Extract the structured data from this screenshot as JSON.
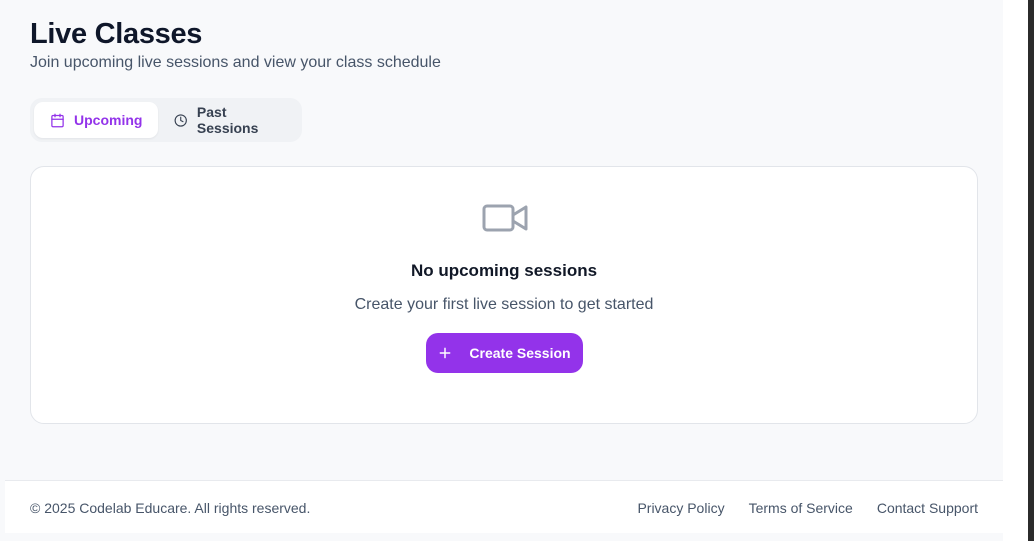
{
  "header": {
    "title": "Live Classes",
    "subtitle": "Join upcoming live sessions and view your class schedule"
  },
  "tabs": [
    {
      "label": "Upcoming",
      "icon": "calendar-icon",
      "active": true
    },
    {
      "label": "Past Sessions",
      "icon": "clock-icon",
      "active": false
    }
  ],
  "empty_state": {
    "icon": "video-camera-icon",
    "title": "No upcoming sessions",
    "description": "Create your first live session to get started",
    "button_label": "Create Session",
    "button_icon": "plus-icon"
  },
  "footer": {
    "copyright": "© 2025 Codelab Educare. All rights reserved.",
    "links": [
      "Privacy Policy",
      "Terms of Service",
      "Contact Support"
    ]
  },
  "colors": {
    "accent": "#9333ea",
    "background": "#f8f9fb",
    "card": "#ffffff",
    "muted_icon": "#9ca3af"
  }
}
